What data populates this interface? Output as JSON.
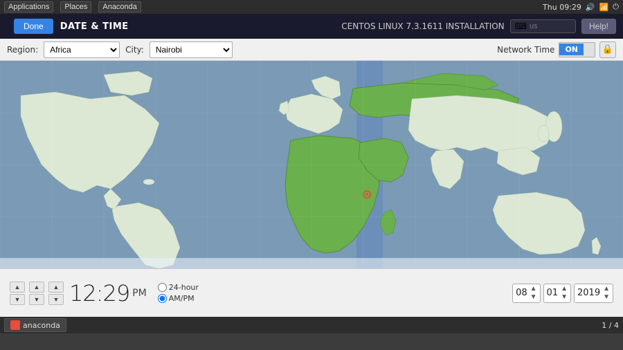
{
  "systembar": {
    "apps_label": "Applications",
    "places_label": "Places",
    "anaconda_label": "Anaconda",
    "time": "Thu 09:29",
    "volume_icon": "🔊",
    "network_icon": "📶"
  },
  "header": {
    "title": "DATE & TIME",
    "done_label": "Done",
    "centos_title": "CENTOS LINUX 7.3.1611 INSTALLATION",
    "search_placeholder": "us",
    "help_label": "Help!"
  },
  "controls": {
    "region_label": "Region:",
    "region_value": "Africa",
    "city_label": "City:",
    "city_value": "Nairobi",
    "network_time_label": "Network Time",
    "toggle_on": "ON",
    "toggle_off": "",
    "lock_icon": "🔒"
  },
  "time": {
    "hours": "12",
    "minutes": "29",
    "ampm": "PM",
    "format_24h": "24-hour",
    "format_ampm": "AM/PM"
  },
  "date": {
    "month": "08",
    "day": "01",
    "year": "2019"
  },
  "taskbar": {
    "item_label": "anaconda",
    "page_info": "1 / 4"
  },
  "map": {
    "ocean_color": "#7a9ab5",
    "land_color": "#dce8d4",
    "highlight_color": "#6ab04c",
    "stripe_color": "rgba(90,130,190,0.45)",
    "marker_color": "#e74c3c"
  }
}
